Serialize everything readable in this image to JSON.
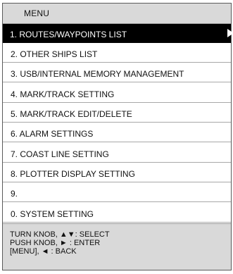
{
  "menu": {
    "title": "MENU",
    "items": [
      {
        "label": "1. ROUTES/WAYPOINTS LIST",
        "selected": true
      },
      {
        "label": "2. OTHER SHIPS LIST",
        "selected": false
      },
      {
        "label": "3. USB/INTERNAL MEMORY MANAGEMENT",
        "selected": false
      },
      {
        "label": "4. MARK/TRACK SETTING",
        "selected": false
      },
      {
        "label": "5. MARK/TRACK EDIT/DELETE",
        "selected": false
      },
      {
        "label": "6. ALARM SETTINGS",
        "selected": false
      },
      {
        "label": "7. COAST LINE SETTING",
        "selected": false
      },
      {
        "label": "8. PLOTTER DISPLAY SETTING",
        "selected": false
      },
      {
        "label": "9.",
        "selected": false
      },
      {
        "label": "0. SYSTEM SETTING",
        "selected": false
      }
    ],
    "selected_icon": "right-arrow-icon"
  },
  "help": {
    "lines": [
      "TURN KNOB, ▲▼: SELECT",
      "PUSH KNOB, ►     : ENTER",
      "[MENU], ◄ : BACK"
    ]
  },
  "colors": {
    "title_bar": "#d9d9d9",
    "selected_background": "#000000",
    "selected_text": "#ffffff",
    "help_background": "#d9d9d9"
  }
}
